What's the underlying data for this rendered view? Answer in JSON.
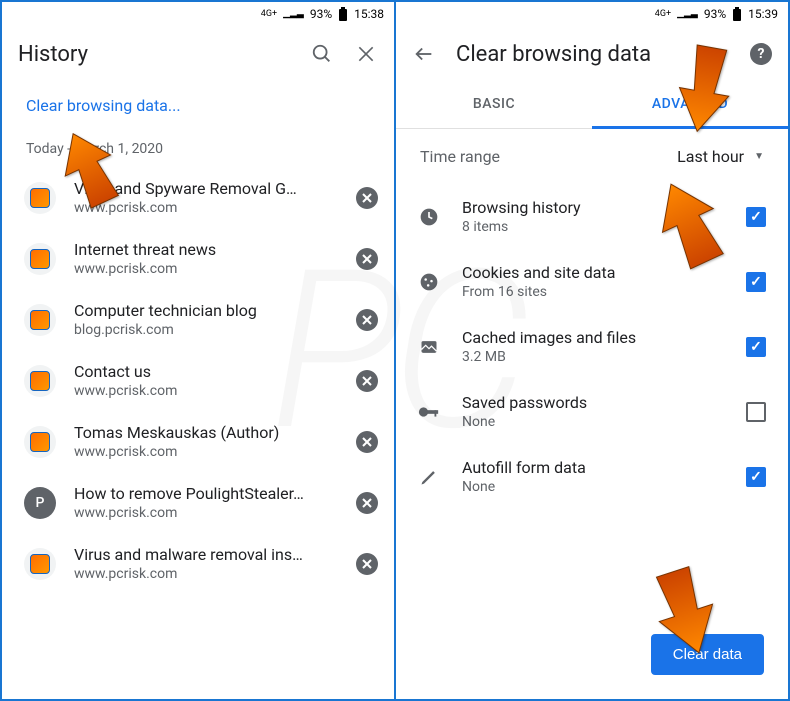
{
  "left": {
    "status": {
      "network": "4G+",
      "signal": "▁▂▃",
      "battery_pct": "93%",
      "time": "15:38"
    },
    "header": {
      "title": "History"
    },
    "clear_link": "Clear browsing data...",
    "date": "Today - March 1, 2020",
    "items": [
      {
        "title": "Virus and Spyware Removal G…",
        "url": "www.pcrisk.com",
        "icon": "pcrisk"
      },
      {
        "title": "Internet threat news",
        "url": "www.pcrisk.com",
        "icon": "pcrisk"
      },
      {
        "title": "Computer technician blog",
        "url": "blog.pcrisk.com",
        "icon": "pcrisk"
      },
      {
        "title": "Contact us",
        "url": "www.pcrisk.com",
        "icon": "pcrisk"
      },
      {
        "title": "Tomas Meskauskas (Author)",
        "url": "www.pcrisk.com",
        "icon": "pcrisk"
      },
      {
        "title": "How to remove PoulightStealer…",
        "url": "www.pcrisk.com",
        "icon": "letter",
        "letter": "P"
      },
      {
        "title": "Virus and malware removal ins…",
        "url": "www.pcrisk.com",
        "icon": "pcrisk"
      }
    ]
  },
  "right": {
    "status": {
      "network": "4G+",
      "signal": "▁▂▃",
      "battery_pct": "93%",
      "time": "15:39"
    },
    "header": {
      "title": "Clear browsing data"
    },
    "tabs": {
      "basic": "BASIC",
      "advanced": "ADVANCED",
      "active": "advanced"
    },
    "time_range": {
      "label": "Time range",
      "value": "Last hour"
    },
    "options": [
      {
        "icon": "clock",
        "title": "Browsing history",
        "sub": "8 items",
        "checked": true
      },
      {
        "icon": "cookie",
        "title": "Cookies and site data",
        "sub": "From 16 sites",
        "checked": true
      },
      {
        "icon": "image",
        "title": "Cached images and files",
        "sub": "3.2 MB",
        "checked": true
      },
      {
        "icon": "key",
        "title": "Saved passwords",
        "sub": "None",
        "checked": false
      },
      {
        "icon": "pencil",
        "title": "Autofill form data",
        "sub": "None",
        "checked": true
      }
    ],
    "clear_button": "Clear data"
  },
  "watermark": "PC"
}
